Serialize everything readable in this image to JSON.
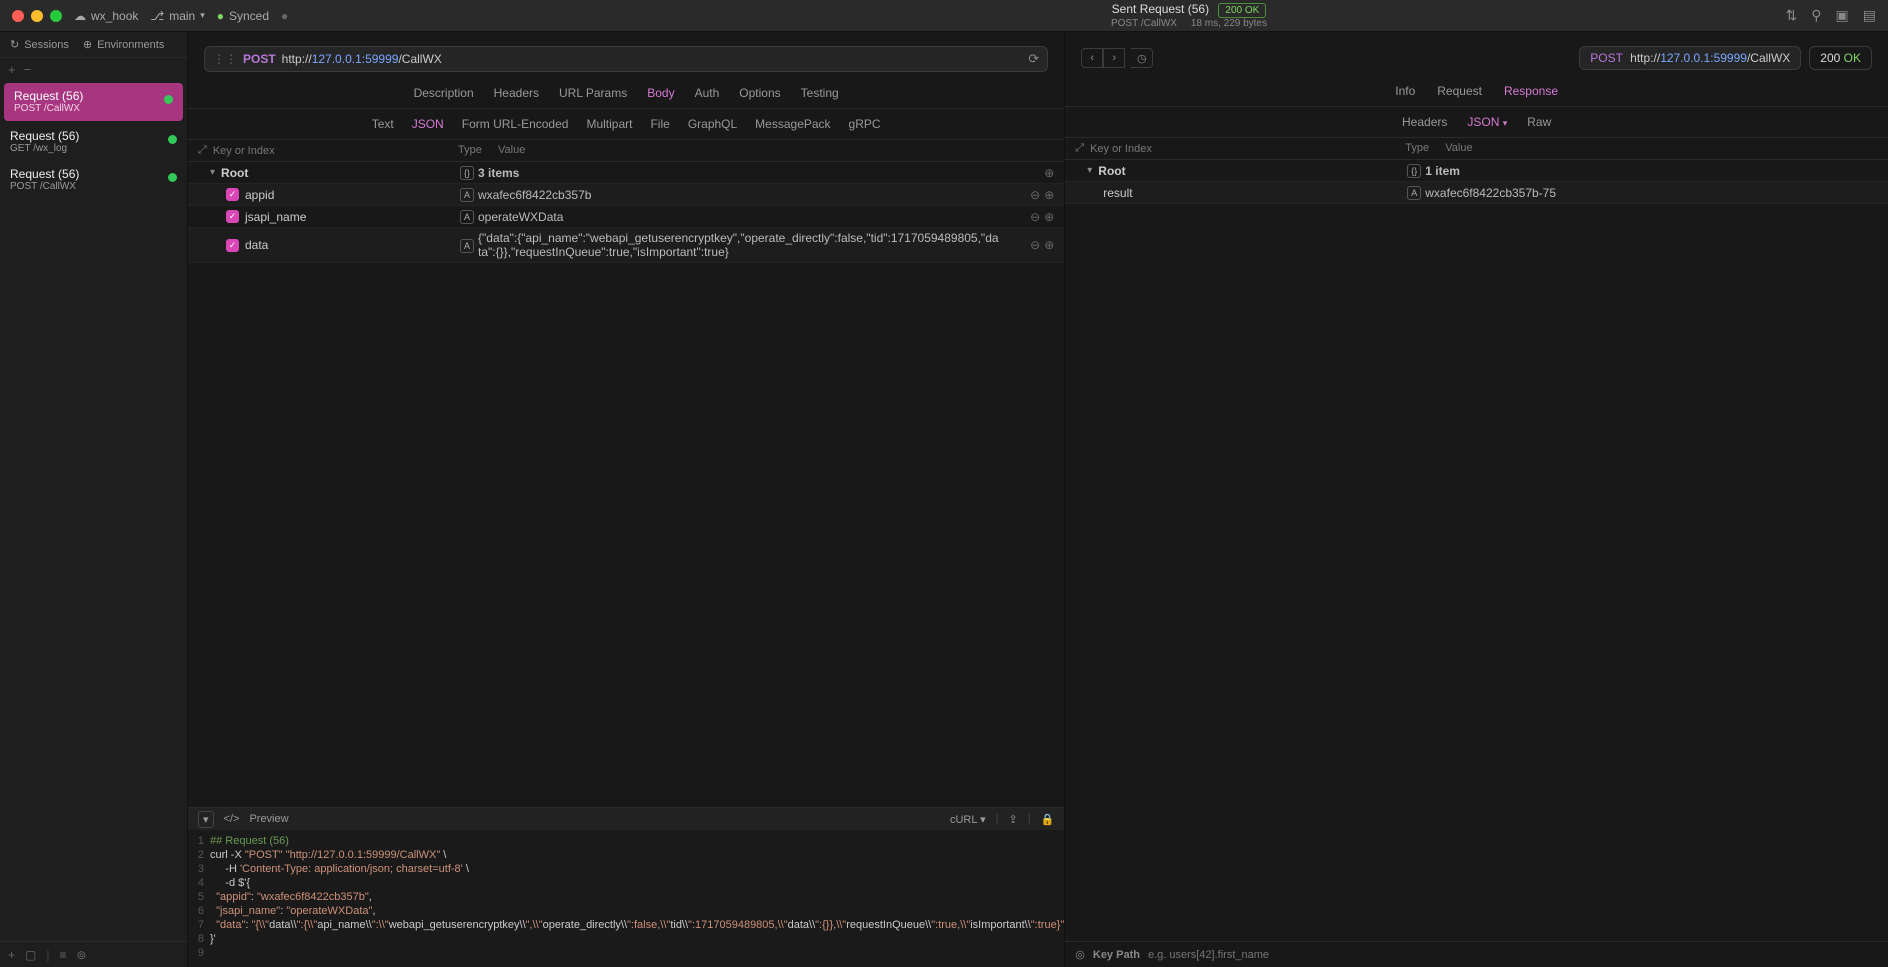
{
  "titlebar": {
    "project": "wx_hook",
    "branch": "main",
    "sync": "Synced",
    "center_title": "Sent Request (56)",
    "center_sub_method": "POST",
    "center_sub_path": "/CallWX",
    "badge": "200 OK",
    "meta": "18 ms, 229 bytes"
  },
  "sidebar": {
    "sessions": "Sessions",
    "environments": "Environments",
    "items": [
      {
        "name": "Request (56)",
        "sub": "POST /CallWX",
        "active": true
      },
      {
        "name": "Request (56)",
        "sub": "GET /wx_log",
        "active": false
      },
      {
        "name": "Request (56)",
        "sub": "POST /CallWX",
        "active": false
      }
    ]
  },
  "url": {
    "method": "POST",
    "prefix": "http://",
    "host": "127.0.0.1:59999",
    "path": "/CallWX"
  },
  "tabs": {
    "main": [
      "Description",
      "Headers",
      "URL Params",
      "Body",
      "Auth",
      "Options",
      "Testing"
    ],
    "main_active": "Body",
    "body": [
      "Text",
      "JSON",
      "Form URL-Encoded",
      "Multipart",
      "File",
      "GraphQL",
      "MessagePack",
      "gRPC"
    ],
    "body_active": "JSON"
  },
  "body_grid": {
    "head_key": "Key or Index",
    "head_type": "Type",
    "head_value": "Value",
    "root": "Root",
    "root_value": "3 items",
    "rows": [
      {
        "key": "appid",
        "t": "A",
        "value": "wxafec6f8422cb357b"
      },
      {
        "key": "jsapi_name",
        "t": "A",
        "value": "operateWXData"
      },
      {
        "key": "data",
        "t": "A",
        "value": "{\"data\":{\"api_name\":\"webapi_getuserencryptkey\",\"operate_directly\":false,\"tid\":1717059489805,\"data\":{}},\"requestInQueue\":true,\"isImportant\":true}"
      }
    ]
  },
  "code": {
    "preview": "Preview",
    "lang": "cURL",
    "lines": [
      "## Request (56)",
      "curl -X \"POST\" \"http://127.0.0.1:59999/CallWX\" \\",
      "     -H 'Content-Type: application/json; charset=utf-8' \\",
      "     -d $'{",
      "  \"appid\": \"wxafec6f8422cb357b\",",
      "  \"jsapi_name\": \"operateWXData\",",
      "  \"data\": \"{\\\\\"data\\\\\":{\\\\\"api_name\\\\\":\\\\\"webapi_getuserencryptkey\\\\\",\\\\\"operate_directly\\\\\":false,\\\\\"tid\\\\\":1717059489805,\\\\\"data\\\\\":{}},\\\\\"requestInQueue\\\\\":true,\\\\\"isImportant\\\\\":true}\"",
      "}'",
      ""
    ]
  },
  "response": {
    "method": "POST",
    "url_prefix": "http://",
    "url_host": "127.0.0.1:59999",
    "url_path": "/CallWX",
    "status_code": "200",
    "status_text": "OK",
    "tabs": [
      "Info",
      "Request",
      "Response"
    ],
    "tabs_active": "Response",
    "sub": [
      "Headers",
      "JSON",
      "Raw"
    ],
    "sub_active": "JSON",
    "head_key": "Key or Index",
    "head_type": "Type",
    "head_value": "Value",
    "root": "Root",
    "root_value": "1 item",
    "rows": [
      {
        "key": "result",
        "t": "A",
        "value": "wxafec6f8422cb357b-75"
      }
    ],
    "keypath_label": "Key Path",
    "keypath_placeholder": "e.g. users[42].first_name"
  }
}
